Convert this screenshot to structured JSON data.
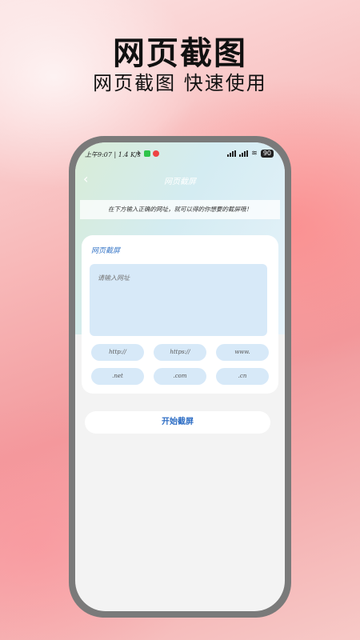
{
  "hero": {
    "title": "网页截图",
    "subtitle": "网页截图 快速使用"
  },
  "status_bar": {
    "time": "上午9:07 | 1.4 K/s",
    "battery": "90"
  },
  "nav": {
    "back_icon": "chevron-left-icon",
    "title": "网页截屏"
  },
  "notice": "在下方输入正确的网址，就可以得的你想要的截屏哦！",
  "card": {
    "label": "网页截屏",
    "url_placeholder": "请输入网址",
    "chips": [
      "http://",
      "https://",
      "www.",
      ".net",
      ".com",
      ".cn"
    ]
  },
  "start_button": "开始截屏",
  "colors": {
    "accent": "#2b6cc4",
    "chip_bg": "#d7e9f8",
    "phone_frame": "#7a7a7a"
  }
}
